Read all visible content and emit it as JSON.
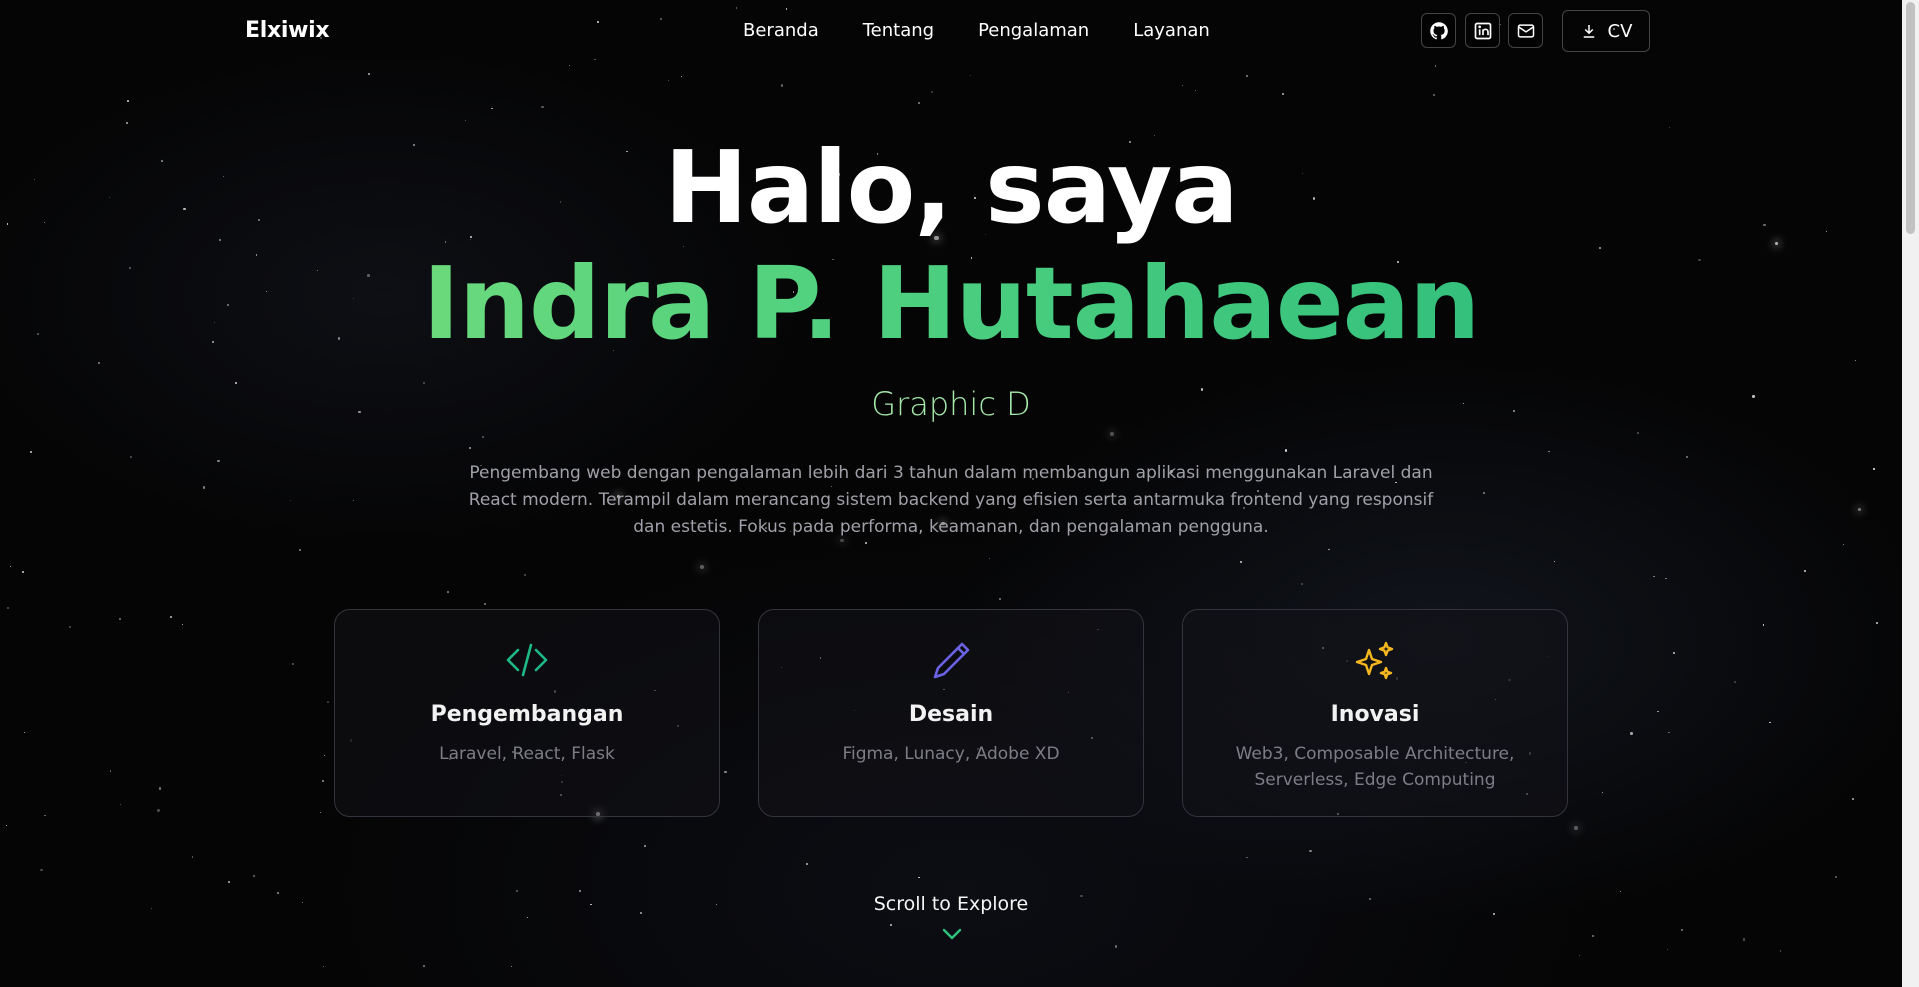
{
  "header": {
    "logo": "Elxiwix",
    "nav": [
      "Beranda",
      "Tentang",
      "Pengalaman",
      "Layanan"
    ],
    "social_icons": [
      "github-icon",
      "linkedin-icon",
      "mail-icon"
    ],
    "cv_label": "CV"
  },
  "hero": {
    "greeting": "Halo, saya",
    "name": "Indra P. Hutahaean",
    "role_typing": "Graphic D",
    "description": "Pengembang web dengan pengalaman lebih dari 3 tahun dalam membangun aplikasi menggunakan Laravel dan React modern. Terampil dalam merancang sistem backend yang efisien serta antarmuka frontend yang responsif dan estetis. Fokus pada performa, keamanan, dan pengalaman pengguna."
  },
  "cards": [
    {
      "icon": "code-icon",
      "title": "Pengembangan",
      "desc": "Laravel, React, Flask",
      "icon_color": "#1fb884"
    },
    {
      "icon": "pen-icon",
      "title": "Desain",
      "desc": "Figma, Lunacy, Adobe XD",
      "icon_color": "#6b63e6"
    },
    {
      "icon": "sparkles-icon",
      "title": "Inovasi",
      "desc": "Web3, Composable Architecture, Serverless, Edge Computing",
      "icon_color": "#f4b71e"
    }
  ],
  "scroll_hint": "Scroll to Explore",
  "colors": {
    "background": "#050506",
    "accent_green": "#4fd07f",
    "subtitle_green": "#a5e8a8"
  }
}
